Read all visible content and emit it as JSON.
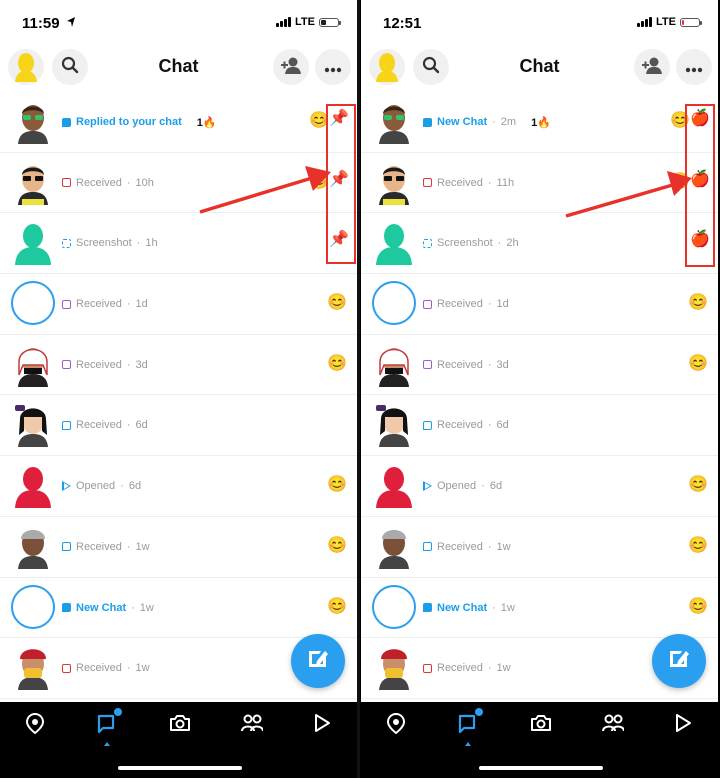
{
  "screens": [
    {
      "time": "11:59",
      "network": "LTE",
      "battery_color": "#222222",
      "battery_level": 0.3,
      "location_arrow": true,
      "title": "Chat",
      "marker_emoji": "📌",
      "chats": [
        {
          "status_kind": "Replied to your chat",
          "time_ago": "",
          "icon": "chat-solid-blue",
          "highlight": true,
          "streak": "1",
          "streak_emoji": "🔥",
          "friend_emoji": "😊",
          "avatar": "bitmoji-green-glasses",
          "marker": true
        },
        {
          "status_kind": "Received",
          "time_ago": "10h",
          "icon": "square-red",
          "highlight": false,
          "streak": "",
          "streak_emoji": "",
          "friend_emoji": "😊",
          "avatar": "bitmoji-sunglasses",
          "marker": true
        },
        {
          "status_kind": "Screenshot",
          "time_ago": "1h",
          "icon": "screenshot-blue",
          "highlight": false,
          "streak": "",
          "streak_emoji": "",
          "friend_emoji": "",
          "avatar": "silhouette-green",
          "marker": true
        },
        {
          "status_kind": "Received",
          "time_ago": "1d",
          "icon": "square-purple",
          "highlight": false,
          "streak": "",
          "streak_emoji": "",
          "friend_emoji": "😊",
          "avatar": "ring-blue",
          "marker": false
        },
        {
          "status_kind": "Received",
          "time_ago": "3d",
          "icon": "square-purple",
          "highlight": false,
          "streak": "",
          "streak_emoji": "",
          "friend_emoji": "😊",
          "avatar": "bitmoji-keffiyeh",
          "marker": false
        },
        {
          "status_kind": "Received",
          "time_ago": "6d",
          "icon": "chat-blue",
          "highlight": false,
          "streak": "",
          "streak_emoji": "",
          "friend_emoji": "",
          "avatar": "bitmoji-black-hair",
          "marker": false
        },
        {
          "status_kind": "Opened",
          "time_ago": "6d",
          "icon": "arrow-blue",
          "highlight": false,
          "streak": "",
          "streak_emoji": "",
          "friend_emoji": "😊",
          "avatar": "silhouette-red",
          "marker": false
        },
        {
          "status_kind": "Received",
          "time_ago": "1w",
          "icon": "chat-blue",
          "highlight": false,
          "streak": "",
          "streak_emoji": "",
          "friend_emoji": "😊",
          "avatar": "bitmoji-beanie",
          "marker": false
        },
        {
          "status_kind": "New Chat",
          "time_ago": "1w",
          "icon": "chat-solid-blue",
          "highlight": true,
          "streak": "",
          "streak_emoji": "",
          "friend_emoji": "😊",
          "avatar": "ring-blue",
          "marker": false
        },
        {
          "status_kind": "Received",
          "time_ago": "1w",
          "icon": "square-red",
          "highlight": false,
          "streak": "",
          "streak_emoji": "",
          "friend_emoji": "",
          "avatar": "bitmoji-red-cap",
          "marker": false
        }
      ]
    },
    {
      "time": "12:51",
      "network": "LTE",
      "battery_color": "#e0353a",
      "battery_level": 0.12,
      "location_arrow": false,
      "title": "Chat",
      "marker_emoji": "🍎",
      "chats": [
        {
          "status_kind": "New Chat",
          "time_ago": "2m",
          "icon": "chat-solid-blue",
          "highlight": true,
          "streak": "1",
          "streak_emoji": "🔥",
          "friend_emoji": "😊",
          "avatar": "bitmoji-green-glasses",
          "marker": true
        },
        {
          "status_kind": "Received",
          "time_ago": "11h",
          "icon": "square-red",
          "highlight": false,
          "streak": "",
          "streak_emoji": "",
          "friend_emoji": "😊",
          "avatar": "bitmoji-sunglasses",
          "marker": true
        },
        {
          "status_kind": "Screenshot",
          "time_ago": "2h",
          "icon": "screenshot-blue",
          "highlight": false,
          "streak": "",
          "streak_emoji": "",
          "friend_emoji": "",
          "avatar": "silhouette-green",
          "marker": true
        },
        {
          "status_kind": "Received",
          "time_ago": "1d",
          "icon": "square-purple",
          "highlight": false,
          "streak": "",
          "streak_emoji": "",
          "friend_emoji": "😊",
          "avatar": "ring-blue",
          "marker": false
        },
        {
          "status_kind": "Received",
          "time_ago": "3d",
          "icon": "square-purple",
          "highlight": false,
          "streak": "",
          "streak_emoji": "",
          "friend_emoji": "😊",
          "avatar": "bitmoji-keffiyeh",
          "marker": false
        },
        {
          "status_kind": "Received",
          "time_ago": "6d",
          "icon": "chat-blue",
          "highlight": false,
          "streak": "",
          "streak_emoji": "",
          "friend_emoji": "",
          "avatar": "bitmoji-black-hair",
          "marker": false
        },
        {
          "status_kind": "Opened",
          "time_ago": "6d",
          "icon": "arrow-blue",
          "highlight": false,
          "streak": "",
          "streak_emoji": "",
          "friend_emoji": "😊",
          "avatar": "silhouette-red",
          "marker": false
        },
        {
          "status_kind": "Received",
          "time_ago": "1w",
          "icon": "chat-blue",
          "highlight": false,
          "streak": "",
          "streak_emoji": "",
          "friend_emoji": "😊",
          "avatar": "bitmoji-beanie",
          "marker": false
        },
        {
          "status_kind": "New Chat",
          "time_ago": "1w",
          "icon": "chat-solid-blue",
          "highlight": true,
          "streak": "",
          "streak_emoji": "",
          "friend_emoji": "😊",
          "avatar": "ring-blue",
          "marker": false
        },
        {
          "status_kind": "Received",
          "time_ago": "1w",
          "icon": "square-red",
          "highlight": false,
          "streak": "",
          "streak_emoji": "",
          "friend_emoji": "",
          "avatar": "bitmoji-red-cap",
          "marker": false
        }
      ]
    }
  ],
  "nav_items": [
    "map-pin-icon",
    "chat-icon",
    "camera-icon",
    "friends-icon",
    "stories-play-icon"
  ],
  "colors": {
    "accent": "#2a9ff0",
    "annotation_red": "#e8312a",
    "received_red": "#e0353a",
    "received_purple": "#9b5fc7",
    "muted_text": "#9a9a9a"
  }
}
